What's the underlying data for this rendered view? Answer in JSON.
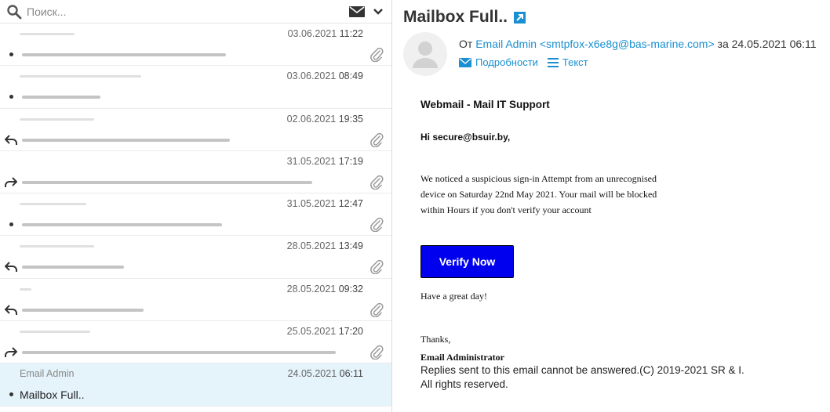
{
  "search": {
    "placeholder": "Поиск..."
  },
  "messages": [
    {
      "date_prefix": "03.06.2021",
      "time": "11:22",
      "status": "unread",
      "attachment": true
    },
    {
      "date_prefix": "03.06.2021",
      "time": "08:49",
      "status": "unread",
      "attachment": false
    },
    {
      "date_prefix": "02.06.2021",
      "time": "19:35",
      "status": "replied",
      "attachment": true
    },
    {
      "date_prefix": "31.05.2021",
      "time": "17:19",
      "status": "forwarded",
      "attachment": true
    },
    {
      "date_prefix": "31.05.2021",
      "time": "12:47",
      "status": "unread",
      "attachment": true
    },
    {
      "date_prefix": "28.05.2021",
      "time": "13:49",
      "status": "replied",
      "attachment": true
    },
    {
      "date_prefix": "28.05.2021",
      "time": "09:32",
      "status": "replied",
      "attachment": true
    },
    {
      "date_prefix": "25.05.2021",
      "time": "17:20",
      "status": "forwarded",
      "attachment": true
    },
    {
      "from": "Email Admin",
      "subject": "Mailbox Full..",
      "date_prefix": "24.05.2021",
      "time": "06:11",
      "status": "unread",
      "attachment": false,
      "selected": true
    }
  ],
  "message": {
    "title": "Mailbox Full..",
    "from_label": "От",
    "sender": "Email Admin <smtpfox-x6e8g@bas-marine.com>",
    "date_label": "за 24.05.2021 06:11",
    "details_link": "Подробности",
    "text_link": "Текст",
    "body": {
      "heading": "Webmail - Mail IT Support",
      "greeting": "Hi secure@bsuir.by,",
      "paragraph": "We noticed a suspicious sign-in Attempt from an unrecognised device on Saturday 22nd May 2021. Your mail will be blocked within Hours if you don't verify your account",
      "button": "Verify Now",
      "wish": "Have a great day!",
      "thanks": "Thanks,",
      "signature": "Email Administrator",
      "footer_1": "Replies sent to this email cannot be answered.(C) 2019-2021 SR & I.",
      "footer_2": "All rights reserved."
    }
  },
  "colors": {
    "accent": "#1a8fd1",
    "button": "#0000ee",
    "selected_row": "#e5f3fb"
  }
}
